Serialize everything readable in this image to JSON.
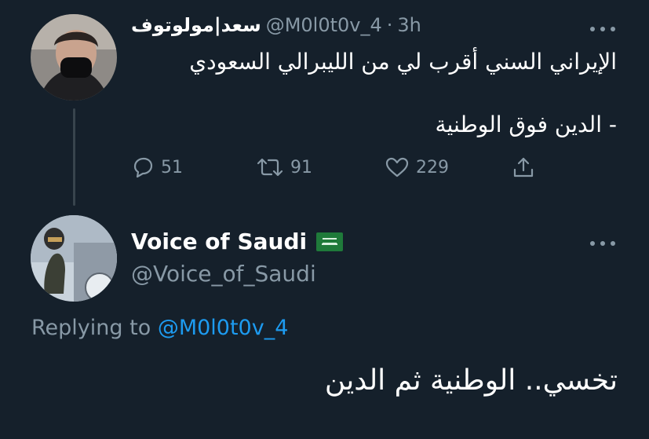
{
  "original": {
    "display_name": "سعد|مولوتوف",
    "handle": "@M0l0t0v_4",
    "separator": "·",
    "time": "3h",
    "text_line1": "الإيراني السني أقرب لي من الليبرالي السعودي",
    "text_line2": "- الدين فوق الوطنية",
    "reply_count": "51",
    "retweet_count": "91",
    "like_count": "229"
  },
  "reply": {
    "display_name": "Voice of Saudi",
    "handle": "@Voice_of_Saudi",
    "replying_prefix": "Replying to",
    "replying_to": "@M0l0t0v_4",
    "text": "تخسي.. الوطنية ثم الدين"
  },
  "colors": {
    "background": "#15202b",
    "text": "#ffffff",
    "muted": "#8899a6",
    "link": "#1d9bf0"
  }
}
